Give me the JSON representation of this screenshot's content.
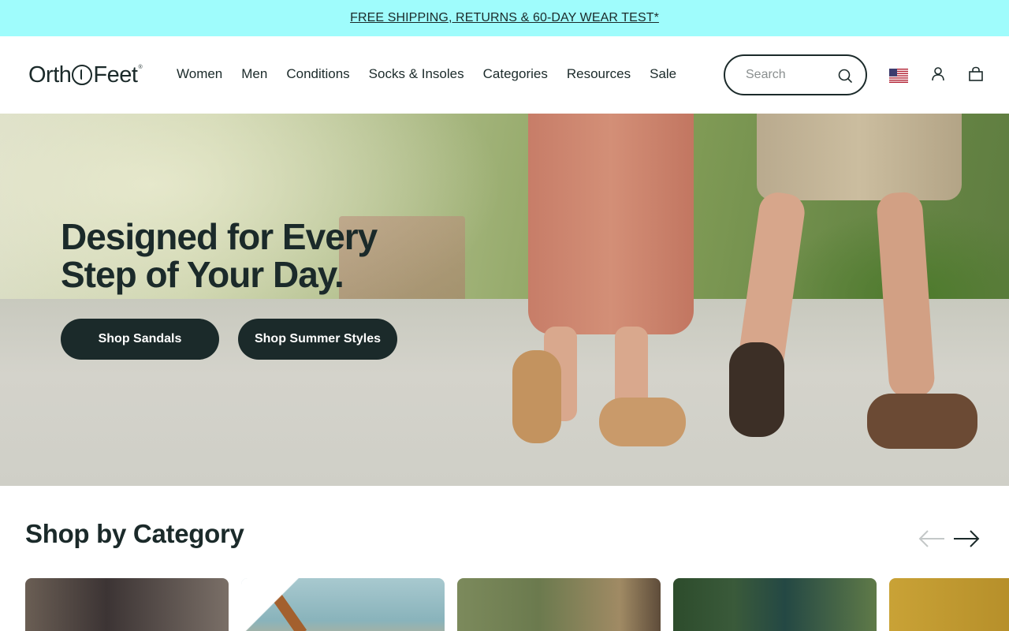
{
  "promo": {
    "text": "FREE SHIPPING, RETURNS & 60-DAY WEAR TEST*"
  },
  "header": {
    "logo": {
      "left": "Orth",
      "right": "Feet",
      "mark": "®"
    },
    "nav": [
      "Women",
      "Men",
      "Conditions",
      "Socks & Insoles",
      "Categories",
      "Resources",
      "Sale"
    ],
    "search": {
      "placeholder": "Search",
      "value": ""
    },
    "icons": [
      "search-icon",
      "us-flag-icon",
      "account-icon",
      "cart-bag-icon"
    ]
  },
  "hero": {
    "title_line1": "Designed for Every",
    "title_line2": "Step of Your Day.",
    "cta_primary": "Shop Sandals",
    "cta_secondary": "Shop Summer Styles"
  },
  "category": {
    "title": "Shop by Category",
    "arrows": [
      "arrow-left-icon",
      "arrow-right-icon"
    ]
  },
  "colors": {
    "promo_bg": "#9ffcfc",
    "ink": "#1b2a2a",
    "button_bg": "#1b2a2a",
    "button_text": "#ffffff"
  }
}
